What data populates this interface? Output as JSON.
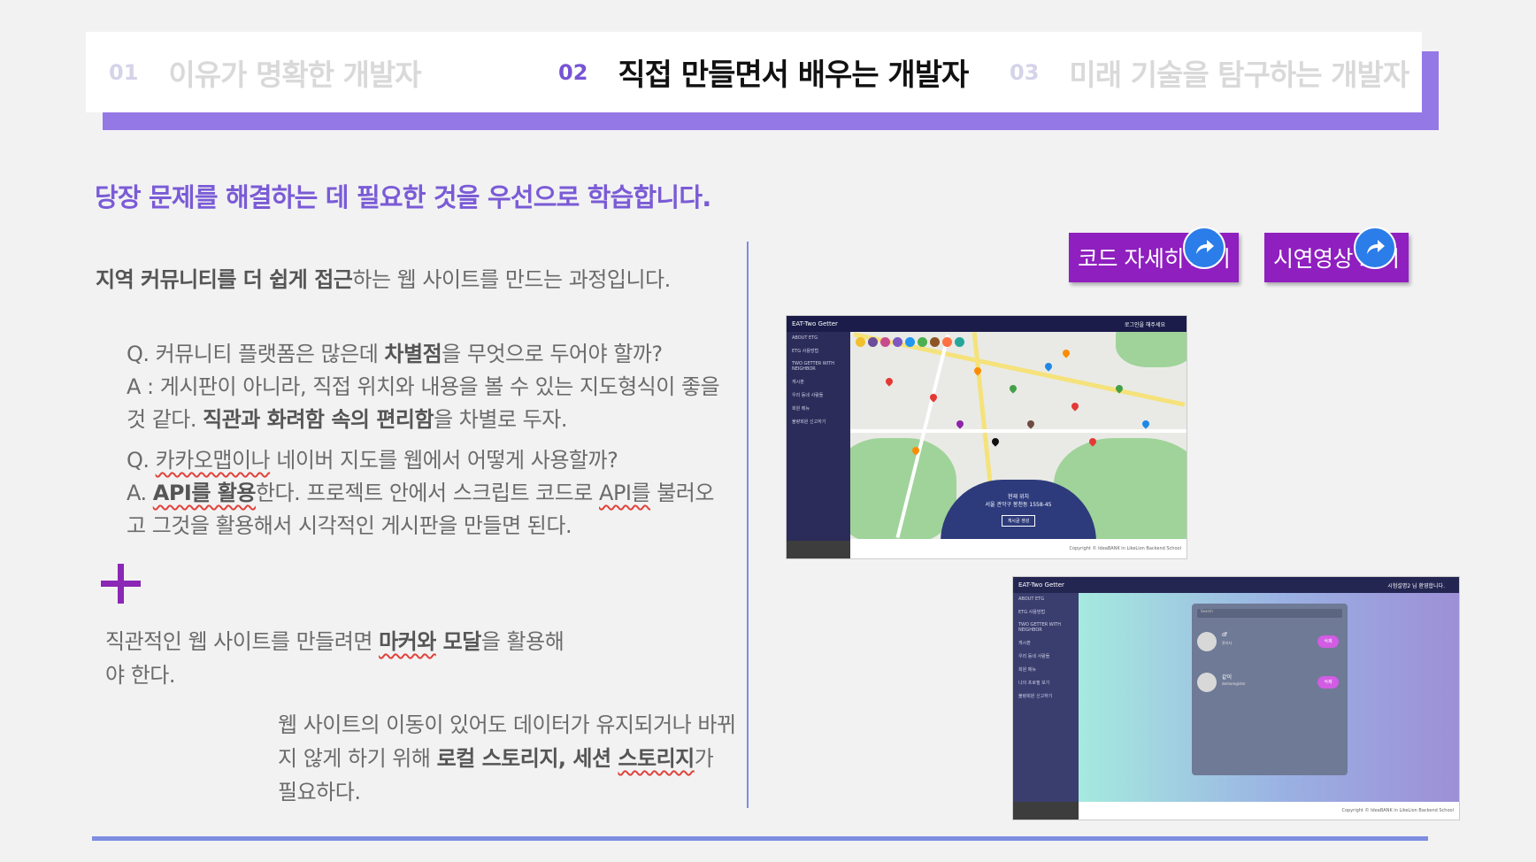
{
  "tabs": [
    {
      "num": "01",
      "label": "이유가 명확한 개발자",
      "active": false
    },
    {
      "num": "02",
      "label": "직접 만들면서 배우는 개발자",
      "active": true
    },
    {
      "num": "03",
      "label": "미래 기술을 탐구하는 개발자",
      "active": false
    }
  ],
  "headline": "당장 문제를 해결하는 데 필요한 것을 우선으로 학습합니다.",
  "intro": {
    "bold": "지역 커뮤니티를 더 쉽게 접근",
    "rest": "하는 웹 사이트를 만드는 과정입니다."
  },
  "qa1": {
    "q_pre": "Q. 커뮤니티 플랫폼은 많은데 ",
    "q_bold": "차별점",
    "q_post": "을 무엇으로 두어야 할까?",
    "a_pre": "A : 게시판이 아니라, 직접 위치와 내용을 볼 수 있는 지도형식이 좋을 것 같다. ",
    "a_bold": "직관과 화려함 속의 편리함",
    "a_post": "을 차별로 두자."
  },
  "qa2": {
    "q_pre": "Q. ",
    "q_mark": "카카오맵이나",
    "q_post": " 네이버 지도를 웹에서 어떻게 사용할까?",
    "a_pre": "A. ",
    "a_bold": "API를 활용",
    "a_mid": "한다. 프로젝트 안에서 스크립트 코드로 ",
    "a_mark": "API를",
    "a_post": " 불러오고 그것을 활용해서 시각적인 게시판을 만들면 된다."
  },
  "note1": {
    "pre": "직관적인 웹 사이트를 만들려면 ",
    "mark": "마커와",
    "bold": " 모달",
    "post": "을 활용해야 한다."
  },
  "note2": {
    "pre": "웹 사이트의 이동이 있어도 데이터가 유지되거나 바뀌지 않게 하기 위해 ",
    "bold1": "로컬 스토리지, 세션 ",
    "mark": "스토리지",
    "post": "가 필요하다."
  },
  "buttons": {
    "code": "코드 자세히 보기",
    "demo": "시연영상 보기"
  },
  "shot1": {
    "brand": "EAT-Two Getter",
    "login": "로그인을 해주세요",
    "menu": [
      "ABOUT ETG",
      "ETG 사용방법",
      "TWO GETTER WITH NEIGHBOR",
      "게시판",
      "우리 동네 사람들",
      "회원 메뉴",
      "불량회원 신고하기"
    ],
    "panel_title": "현재 위치",
    "panel_addr": "서울 관악구 봉천동 1558-45",
    "panel_btn": "게시글 생성",
    "copyright": "Copyright © IdeaBANK in LikeLion Backend School"
  },
  "shot2": {
    "brand": "EAT-Two Getter",
    "user": "시험설명2 님 환영합니다.",
    "menu": [
      "ABOUT ETG",
      "ETG 사용방법",
      "TWO GETTER WITH NEIGHBOR",
      "게시판",
      "우리 동네 사람들",
      "회원 메뉴",
      "나의 프로필 보기",
      "불량회원 신고하기"
    ],
    "search": "Search",
    "rows": [
      {
        "name": "df",
        "sub": "관리자",
        "btn": "삭제"
      },
      {
        "name": "같이",
        "sub": "demoregister",
        "btn": "삭제"
      }
    ],
    "copyright": "Copyright © IdeaBANK in LikeLion Backend School"
  }
}
